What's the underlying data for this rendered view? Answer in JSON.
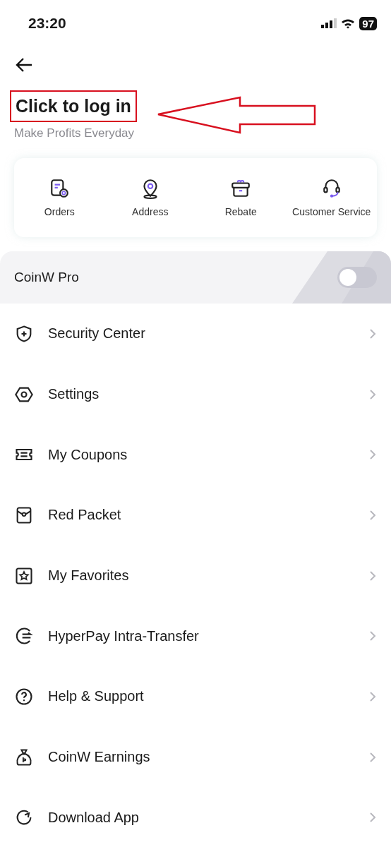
{
  "status_bar": {
    "time": "23:20",
    "battery": "97"
  },
  "header": {
    "title": "Click to log in",
    "title_highlighted": true,
    "subtitle": "Make Profits Everyday"
  },
  "shortcuts": [
    {
      "label": "Orders"
    },
    {
      "label": "Address"
    },
    {
      "label": "Rebate"
    },
    {
      "label": "Customer Service"
    }
  ],
  "pro_mode": {
    "label": "CoinW Pro",
    "on": false
  },
  "menu": [
    {
      "label": "Security Center"
    },
    {
      "label": "Settings"
    },
    {
      "label": "My Coupons"
    },
    {
      "label": "Red Packet"
    },
    {
      "label": "My Favorites"
    },
    {
      "label": "HyperPay Intra-Transfer"
    },
    {
      "label": "Help & Support"
    },
    {
      "label": "CoinW Earnings"
    },
    {
      "label": "Download App"
    }
  ]
}
